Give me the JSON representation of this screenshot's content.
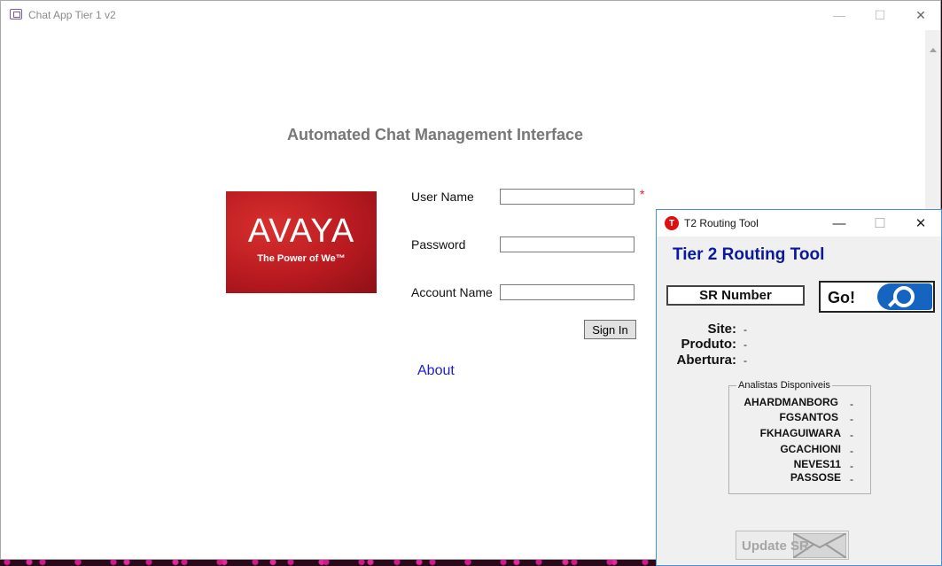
{
  "main_window": {
    "title": "Chat App Tier 1 v2",
    "controls": {
      "minimize": "—",
      "maximize": "☐",
      "close": "✕"
    },
    "heading": "Automated Chat Management Interface",
    "logo": {
      "brand": "AVAYA",
      "tagline": "The Power of We™"
    },
    "form": {
      "username_label": "User Name",
      "username_value": "",
      "password_label": "Password",
      "password_value": "",
      "account_label": "Account Name",
      "account_value": "",
      "required_mark": "*",
      "signin_label": "Sign In"
    },
    "about_link": "About"
  },
  "routing_window": {
    "title": "T2 Routing Tool",
    "controls": {
      "minimize": "—",
      "maximize": "☐",
      "close": "✕"
    },
    "heading": "Tier 2 Routing Tool",
    "sr_field": "SR Number",
    "go_label": "Go!",
    "info": [
      {
        "label": "Site:",
        "value": "-"
      },
      {
        "label": "Produto:",
        "value": "-"
      },
      {
        "label": "Abertura:",
        "value": "-"
      }
    ],
    "analysts_caption": "Analistas Disponiveis",
    "analysts": [
      {
        "name": "AHARDMANBORG",
        "value": "-"
      },
      {
        "name": "FGSANTOS",
        "value": "-"
      },
      {
        "name": "FKHAGUIWARA",
        "value": "-"
      },
      {
        "name": "GCACHIONI",
        "value": "-"
      },
      {
        "name": "NEVES11",
        "value": "-"
      },
      {
        "name": "PASSOSE",
        "value": "-"
      }
    ],
    "update_label": "Update SR",
    "accent": "#1565c0"
  }
}
